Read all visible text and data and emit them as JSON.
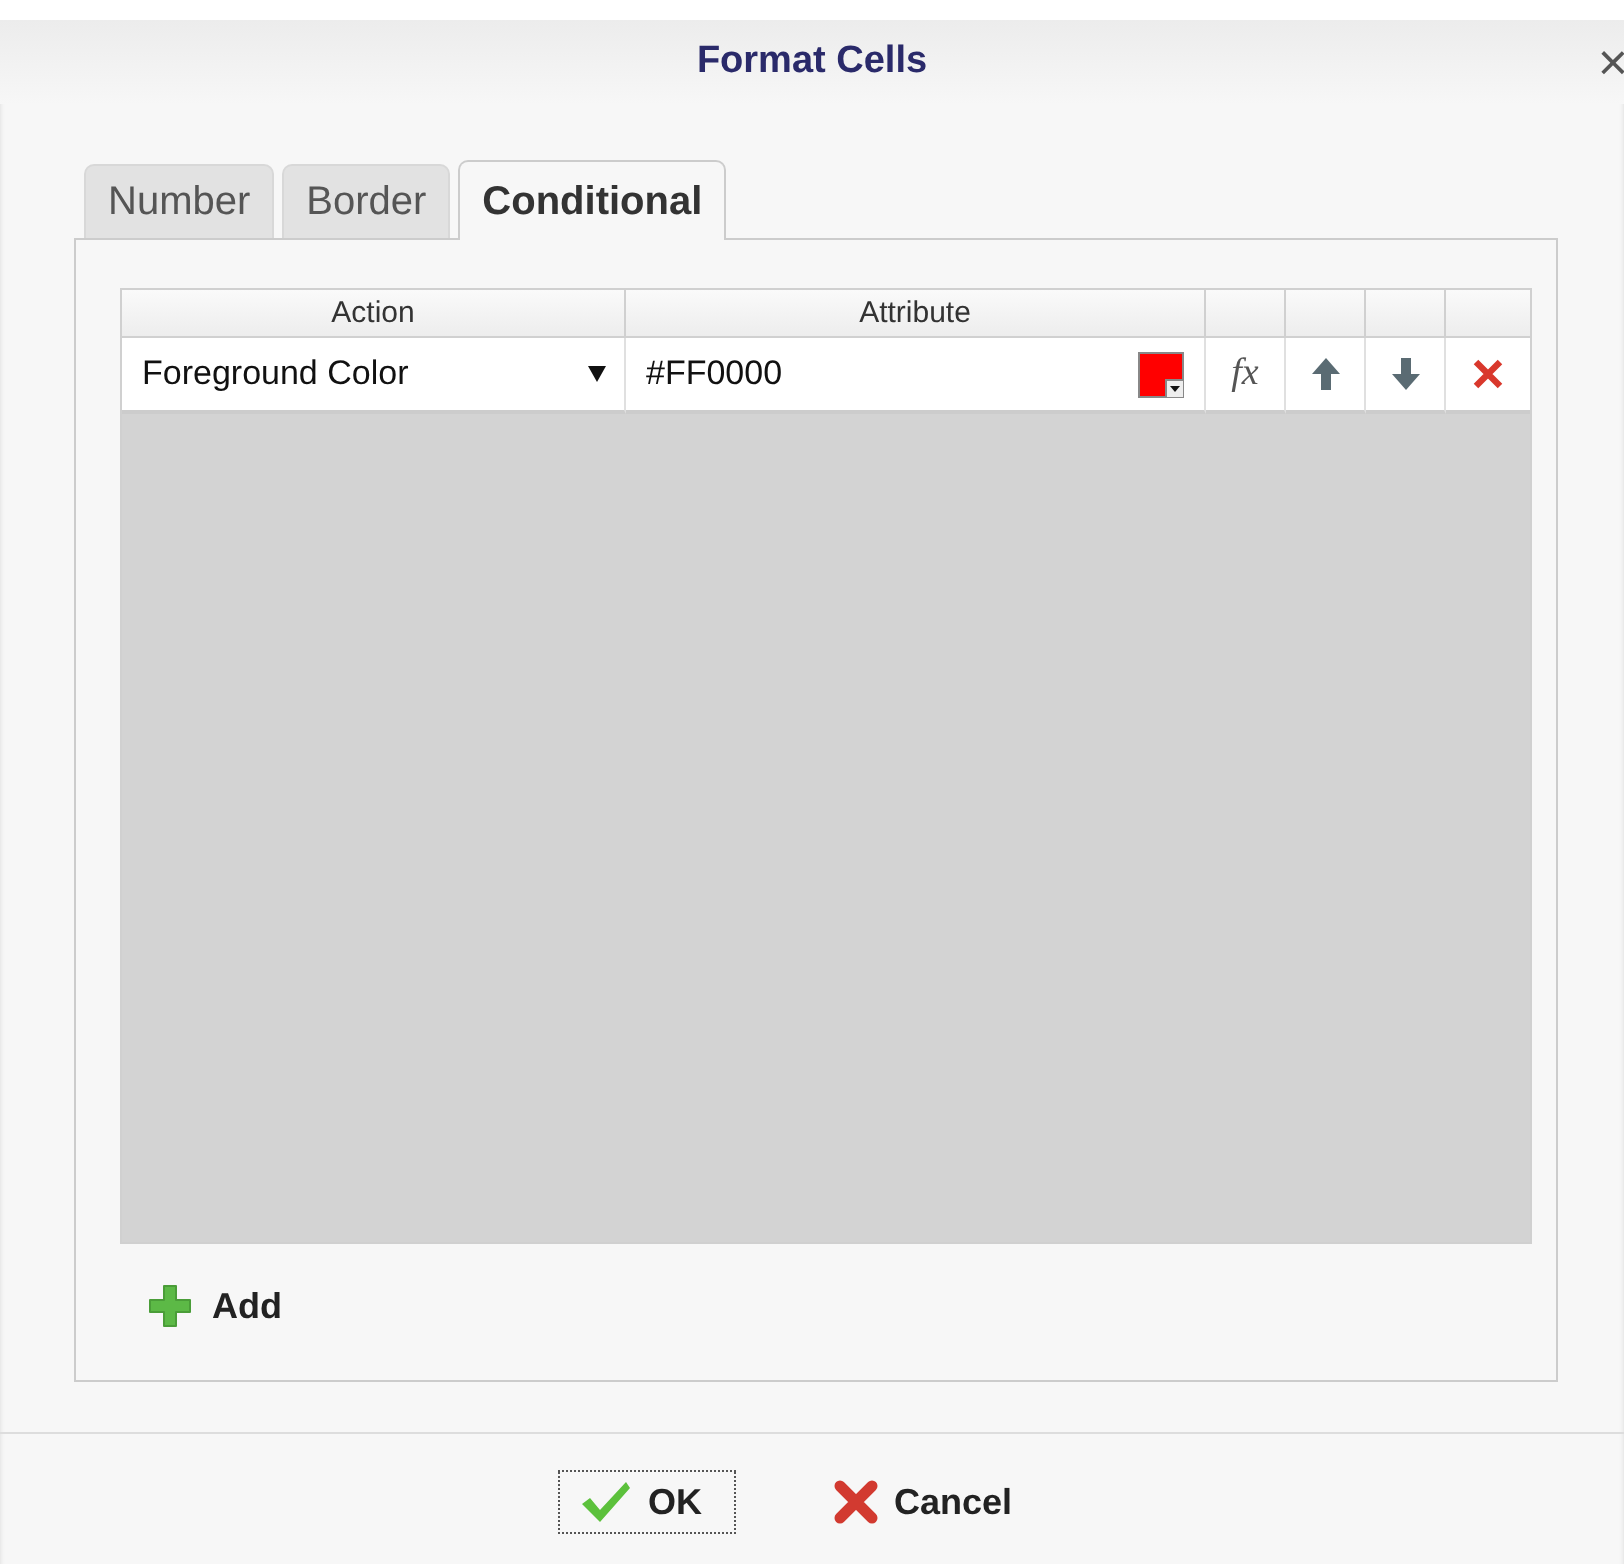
{
  "window": {
    "title": "Format Cells",
    "close": "×"
  },
  "tabs": [
    {
      "label": "Number",
      "selected": false
    },
    {
      "label": "Border",
      "selected": false
    },
    {
      "label": "Conditional",
      "selected": true
    }
  ],
  "table": {
    "columns": [
      "Action",
      "Attribute"
    ],
    "rows": [
      {
        "action": "Foreground Color",
        "attribute": "#FF0000",
        "color": "#ff0000",
        "formula": "fx"
      }
    ]
  },
  "add_button": "Add",
  "buttons": [
    {
      "label": "OK",
      "kind": "ok",
      "focused": true
    },
    {
      "label": "Cancel",
      "kind": "cancel",
      "focused": false
    }
  ]
}
